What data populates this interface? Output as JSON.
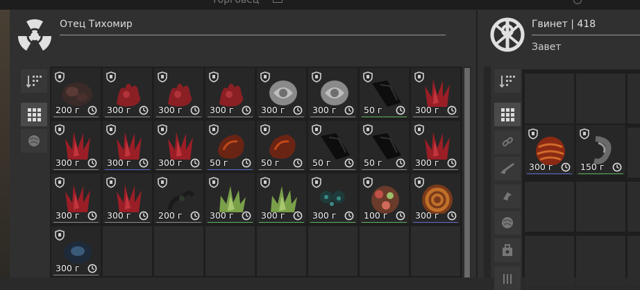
{
  "top": {
    "ghost_text": "Торговец"
  },
  "trader": {
    "name": "Отец Тихомир",
    "icon": "radiation-icon"
  },
  "player": {
    "name": "Гвинет | 418",
    "faction": "Завет",
    "icon": "faction-emblem-icon"
  },
  "colors": {
    "underline_green": "#5db35a",
    "underline_blue": "#5a6ec9",
    "underline_gray": "#8a8a8a"
  },
  "trader_items": [
    {
      "price": "200 г",
      "art": "dark-rock-cluster",
      "line": "gray"
    },
    {
      "price": "300 г",
      "art": "red-coral",
      "line": "gray"
    },
    {
      "price": "300 г",
      "art": "red-coral",
      "line": "gray"
    },
    {
      "price": "300 г",
      "art": "red-coral",
      "line": "gray"
    },
    {
      "price": "300 г",
      "art": "white-rose",
      "line": "gray"
    },
    {
      "price": "300 г",
      "art": "white-rose",
      "line": "gray"
    },
    {
      "price": "50 г",
      "art": "black-shard",
      "line": "green"
    },
    {
      "price": "300 г",
      "art": "red-crystal",
      "line": "gray"
    },
    {
      "price": "300 г",
      "art": "red-crystal",
      "line": "gray"
    },
    {
      "price": "300 г",
      "art": "red-crystal",
      "line": "blue"
    },
    {
      "price": "300 г",
      "art": "red-crystal",
      "line": "gray"
    },
    {
      "price": "50 г",
      "art": "fire-shell",
      "line": "blue"
    },
    {
      "price": "50 г",
      "art": "fire-shell",
      "line": "gray"
    },
    {
      "price": "50 г",
      "art": "black-shard",
      "line": "gray"
    },
    {
      "price": "50 г",
      "art": "black-shard",
      "line": "gray"
    },
    {
      "price": "300 г",
      "art": "red-crystal",
      "line": "gray"
    },
    {
      "price": "300 г",
      "art": "red-crystal",
      "line": "gray"
    },
    {
      "price": "300 г",
      "art": "red-crystal",
      "line": "gray"
    },
    {
      "price": "200 г",
      "art": "dark-vine",
      "line": "gray"
    },
    {
      "price": "300 г",
      "art": "green-crystal",
      "line": "green"
    },
    {
      "price": "300 г",
      "art": "green-crystal",
      "line": "green"
    },
    {
      "price": "300 г",
      "art": "teal-cluster",
      "line": "green"
    },
    {
      "price": "100 г",
      "art": "flower-ball",
      "line": "green"
    },
    {
      "price": "300 г",
      "art": "spiral-sausage",
      "line": "blue"
    },
    {
      "price": "300 г",
      "art": "blue-blob",
      "line": "gray"
    }
  ],
  "player_items": [
    {
      "price": "300 г",
      "art": "red-orb",
      "line": "blue"
    },
    {
      "price": "150 г",
      "art": "gray-spiral",
      "line": "green"
    }
  ]
}
